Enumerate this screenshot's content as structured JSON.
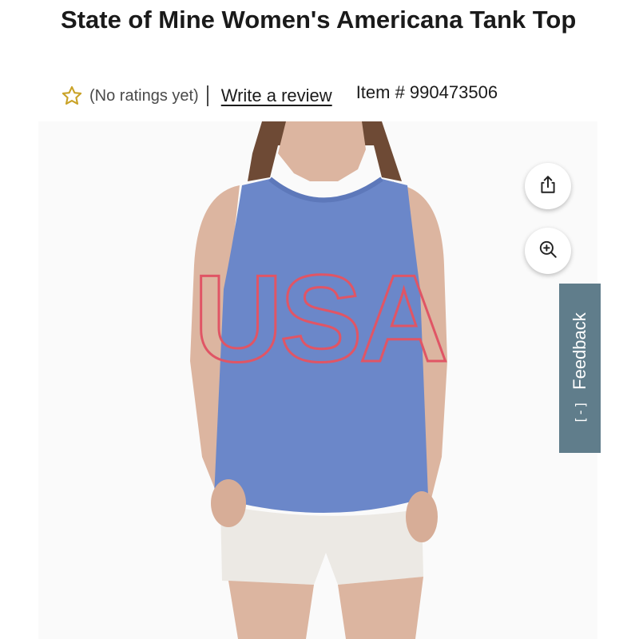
{
  "product": {
    "title": "State of Mine Women's Americana Tank Top",
    "ratings_text": "(No ratings yet)",
    "write_review_label": "Write a review",
    "item_number": "Item # 990473506"
  },
  "image": {
    "shirt_print_text": "USA",
    "alt": "Woman wearing blue Americana tank top with USA print",
    "colors": {
      "shirt": "#6b87c9",
      "print_outline": "#e05565",
      "shorts": "#ece9e4",
      "skin": "#dcb5a0"
    }
  },
  "actions": {
    "share_icon": "share-icon",
    "zoom_icon": "zoom-in-icon"
  },
  "feedback": {
    "label": "Feedback",
    "icon_text": "[-]",
    "color": "#607d8b"
  },
  "colors": {
    "star": "#c9a227",
    "text": "#1b1b1b"
  }
}
